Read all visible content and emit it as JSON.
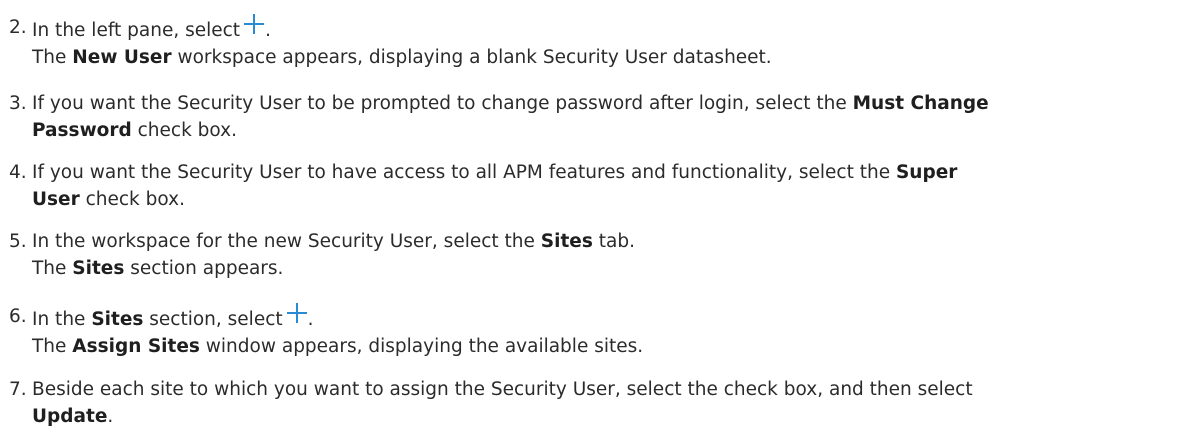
{
  "steps": [
    {
      "number": "2.",
      "line1": {
        "before": "In the left pane, select",
        "after": "."
      },
      "icon": "plus-icon",
      "sub": {
        "before": "The ",
        "bold": "New User",
        "after": " workspace appears, displaying a blank Security User datasheet."
      }
    },
    {
      "number": "3.",
      "line1": {
        "before": "If you want the Security User to be prompted to change password after login, select the ",
        "bold": "Must Change"
      },
      "line2": {
        "bold": "Password",
        "after": " check box."
      }
    },
    {
      "number": "4.",
      "line1": {
        "before": "If you want the Security User to have access to all APM features and functionality, select the ",
        "bold": "Super"
      },
      "line2": {
        "bold": "User",
        "after": " check box."
      }
    },
    {
      "number": "5.",
      "line1": {
        "before": "In the workspace for the new Security User, select the ",
        "bold": "Sites",
        "after": " tab."
      },
      "sub": {
        "before": "The ",
        "bold": "Sites",
        "after": " section appears."
      }
    },
    {
      "number": "6.",
      "line1": {
        "before": "In the ",
        "bold": "Sites",
        "mid": " section, select",
        "after": "."
      },
      "icon": "plus-icon",
      "sub": {
        "before": "The ",
        "bold": "Assign Sites",
        "after": " window appears, displaying the available sites."
      }
    },
    {
      "number": "7.",
      "line1": {
        "before": "Beside each site to which you want to assign the Security User, select the check box, and then select"
      },
      "line2": {
        "bold": "Update",
        "after": "."
      }
    }
  ],
  "colors": {
    "text": "#2b2b2b",
    "icon": "#2a8ad4"
  }
}
